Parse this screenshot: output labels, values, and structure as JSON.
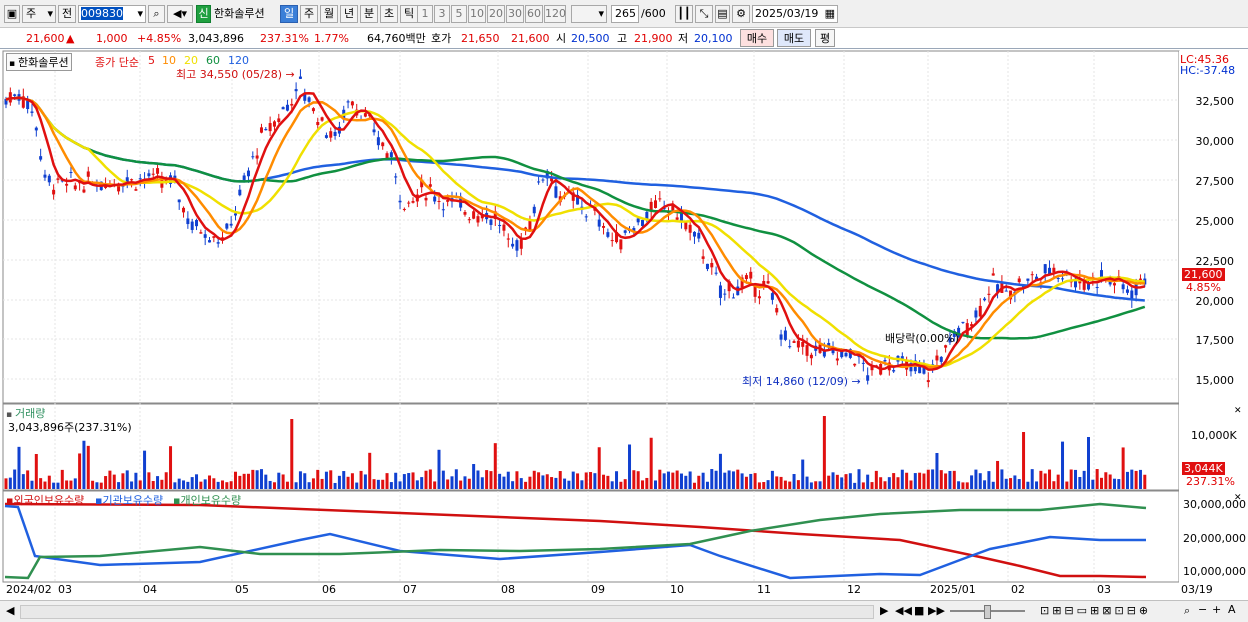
{
  "toolbar": {
    "kind": "주",
    "prefix_btn": "전",
    "code": "009830",
    "stock_badge": "신",
    "stock_name": "한화솔루션",
    "periods": [
      "일",
      "주",
      "월",
      "년",
      "분",
      "초",
      "틱"
    ],
    "active_period": "일",
    "intervals": [
      "1",
      "3",
      "5",
      "10",
      "20",
      "30",
      "60",
      "120"
    ],
    "count": "265",
    "count_total": "/600",
    "date": "2025/03/19"
  },
  "info": {
    "price": "21,600",
    "change_arrow": "▲",
    "change": "1,000",
    "change_pct": "+4.85%",
    "volume": "3,043,896",
    "volume_ratio": "237.31%",
    "turnover": "1.77%",
    "amount": "64,760백만",
    "quote_label": "호가",
    "ask": "21,650",
    "bid": "21,600",
    "open_label": "시",
    "open": "20,500",
    "high_label": "고",
    "high": "21,900",
    "low_label": "저",
    "low": "20,100",
    "buy_btn": "매수",
    "sell_btn": "매도",
    "eval_btn": "평"
  },
  "price_panel": {
    "title": "한화솔루션",
    "ma_label": "종가 단순",
    "ma_periods": [
      "5",
      "10",
      "20",
      "60",
      "120"
    ],
    "ma_colors": [
      "#e01010",
      "#ff8c00",
      "#f0e000",
      "#109040",
      "#2060e0"
    ],
    "high_note": "최고 34,550 (05/28)",
    "low_note": "최저 14,860 (12/09)",
    "dividend_note": "배당락(0.00%)",
    "lc": "LC:45.36",
    "hc": "HC:-37.48",
    "last_price_tag": "21,600",
    "last_pct_tag": "4.85%",
    "y_ticks": [
      "32,500",
      "30,000",
      "27,500",
      "25,000",
      "22,500",
      "20,000",
      "17,500",
      "15,000"
    ]
  },
  "volume_panel": {
    "title": "거래량",
    "value": "3,043,896주(237.31%)",
    "y_tick": "10,000K",
    "last_tag": "3,044K",
    "last_pct": "237.31%"
  },
  "holdings_panel": {
    "legend": [
      "외국인보유수량",
      "기관보유수량",
      "개인보유수량"
    ],
    "colors": [
      "#d01010",
      "#2060e0",
      "#309050"
    ],
    "y_ticks": [
      "30,000,000",
      "20,000,000",
      "10,000,000"
    ]
  },
  "x_axis": [
    "2024/02",
    "03",
    "04",
    "05",
    "06",
    "07",
    "08",
    "09",
    "10",
    "11",
    "12",
    "2025/01",
    "02",
    "03"
  ],
  "x_end_label": "03/19"
}
